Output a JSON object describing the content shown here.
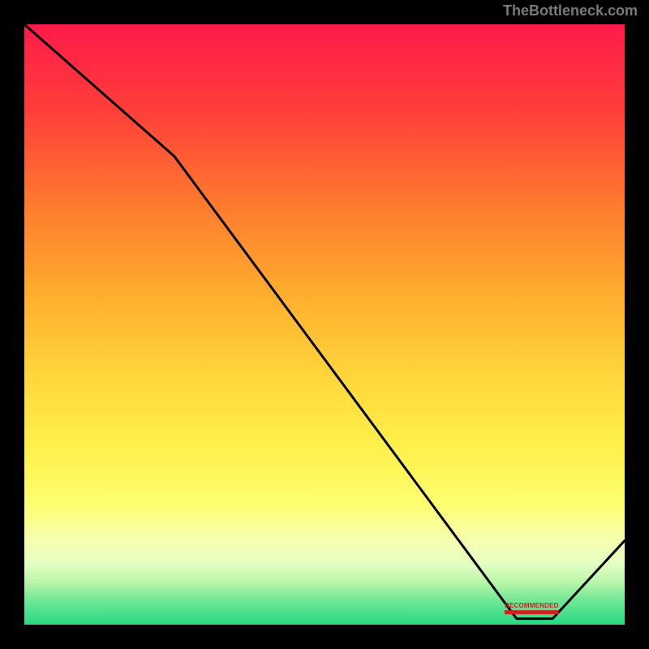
{
  "watermark": "TheBottleneck.com",
  "chart_data": {
    "type": "line",
    "title": "",
    "xlabel": "",
    "ylabel": "",
    "ylim": [
      0,
      100
    ],
    "xlim": [
      0,
      100
    ],
    "series": [
      {
        "name": "bottleneck-curve",
        "x": [
          0,
          25,
          82,
          88,
          100
        ],
        "values": [
          100,
          78,
          1,
          1,
          14
        ]
      }
    ],
    "annotations": [
      {
        "name": "recommended-bar-label",
        "x": 82,
        "y": 2,
        "text": "RECOMMENDED"
      }
    ],
    "background_gradient_stops": [
      {
        "pct": 0,
        "color": "#ff1a4a"
      },
      {
        "pct": 14,
        "color": "#ff3d3a"
      },
      {
        "pct": 30,
        "color": "#ff7a2e"
      },
      {
        "pct": 45,
        "color": "#ffad2e"
      },
      {
        "pct": 58,
        "color": "#ffd43a"
      },
      {
        "pct": 70,
        "color": "#fff04a"
      },
      {
        "pct": 80,
        "color": "#fdff70"
      },
      {
        "pct": 86,
        "color": "#f6ffb0"
      },
      {
        "pct": 90,
        "color": "#e3ffc2"
      },
      {
        "pct": 93,
        "color": "#b8f5a8"
      },
      {
        "pct": 96,
        "color": "#6fe896"
      },
      {
        "pct": 100,
        "color": "#28d884"
      }
    ]
  }
}
